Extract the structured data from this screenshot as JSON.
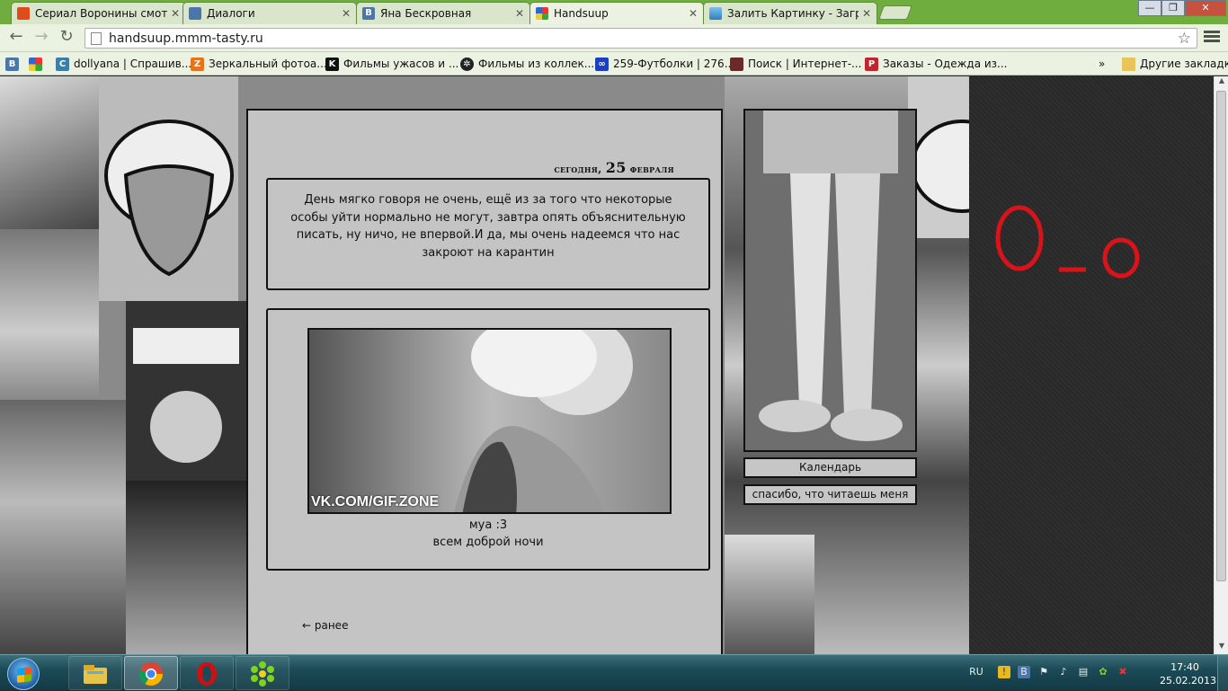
{
  "browser": {
    "tabs": [
      {
        "label": "Сериал Воронины смотр",
        "icon": "fire-icon",
        "color": "#e04b1a"
      },
      {
        "label": "Диалоги",
        "icon": "chat-icon",
        "color": "#4a76a8"
      },
      {
        "label": "Яна Бескровная",
        "icon": "vk-icon",
        "color": "#4a76a8"
      },
      {
        "label": "Handsuup",
        "icon": "tasty-icon",
        "color": "#6fae3e"
      },
      {
        "label": "Залить Картинку - Загру",
        "icon": "image-icon",
        "color": "#2e7fbf"
      }
    ],
    "active_tab": "Handsuup",
    "url": "handsuup.mmm-tasty.ru",
    "window_buttons": {
      "minimize": "—",
      "maximize": "❐",
      "close": "✕"
    },
    "bookmarks": [
      {
        "label": "",
        "icon": "vk-icon"
      },
      {
        "label": "",
        "icon": "apps-icon"
      },
      {
        "label": "dollyana | Спрашив...",
        "icon": "ask-icon"
      },
      {
        "label": "Зеркальный фотоа...",
        "icon": "camera-icon"
      },
      {
        "label": "Фильмы ужасов и ...",
        "icon": "k-icon"
      },
      {
        "label": "Фильмы из коллек...",
        "icon": "film-icon"
      },
      {
        "label": "259-Футболки | 276...",
        "icon": "shirt-icon"
      },
      {
        "label": "Поиск | Интернет-...",
        "icon": "search-icon"
      },
      {
        "label": "Заказы - Одежда из...",
        "icon": "p-icon"
      }
    ],
    "bookmarks_more": "»",
    "other_bookmarks": "Другие закладки"
  },
  "blog": {
    "date": {
      "prefix": "сегодня,",
      "day": "25",
      "month": "февраля"
    },
    "post1_text": "День мягко говоря не очень, ещё из за того что некоторые особы уйти нормально не могут, завтра опять объяснительную писать, ну ничо, не впервой.И да, мы очень надеемся что нас закроют на карантин",
    "post2": {
      "gif_watermark": "VK.COM/GIF.ZONE",
      "caption_line1": "муа :3",
      "caption_line2": "всем доброй ночи"
    },
    "earlier_link": "← ранее",
    "side_links": [
      "Календарь",
      "спасибо, что читаешь меня"
    ]
  },
  "taskbar": {
    "pinned": [
      "explorer-icon",
      "chrome-icon",
      "opera-icon",
      "icq-icon"
    ],
    "language": "RU",
    "time": "17:40",
    "date": "25.02.2013"
  }
}
